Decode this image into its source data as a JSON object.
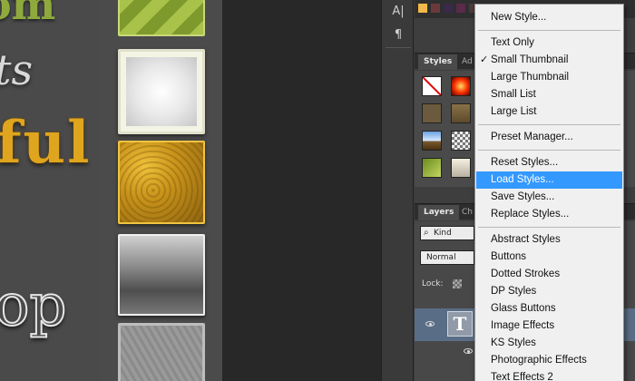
{
  "canvas": {
    "text_1": "om",
    "text_2": "ts",
    "text_3": "ful",
    "text_4": "op"
  },
  "toolbar": {
    "char_tool": "A|",
    "para_tool": "¶"
  },
  "styles_panel": {
    "tabs": [
      "Styles",
      "Ad"
    ]
  },
  "layers_panel": {
    "tabs": [
      "Layers",
      "Ch"
    ],
    "filter_kind": "Kind",
    "blend_mode": "Normal",
    "lock_label": "Lock:",
    "layer_thumb_glyph": "T"
  },
  "menu": {
    "items": [
      {
        "label": "New Style..."
      },
      {
        "label": "Text Only"
      },
      {
        "label": "Small Thumbnail",
        "checked": true
      },
      {
        "label": "Large Thumbnail"
      },
      {
        "label": "Small List"
      },
      {
        "label": "Large List"
      },
      {
        "label": "Preset Manager..."
      },
      {
        "label": "Reset Styles..."
      },
      {
        "label": "Load Styles...",
        "highlighted": true
      },
      {
        "label": "Save Styles..."
      },
      {
        "label": "Replace Styles..."
      },
      {
        "label": "Abstract Styles"
      },
      {
        "label": "Buttons"
      },
      {
        "label": "Dotted Strokes"
      },
      {
        "label": "DP Styles"
      },
      {
        "label": "Glass Buttons"
      },
      {
        "label": "Image Effects"
      },
      {
        "label": "KS Styles"
      },
      {
        "label": "Photographic Effects"
      },
      {
        "label": "Text Effects 2"
      }
    ],
    "checkmark": "✓"
  },
  "colors": {
    "highlight": "#3399ff",
    "menu_bg": "#f0f0f0",
    "panel_bg": "#3e3e3e"
  }
}
